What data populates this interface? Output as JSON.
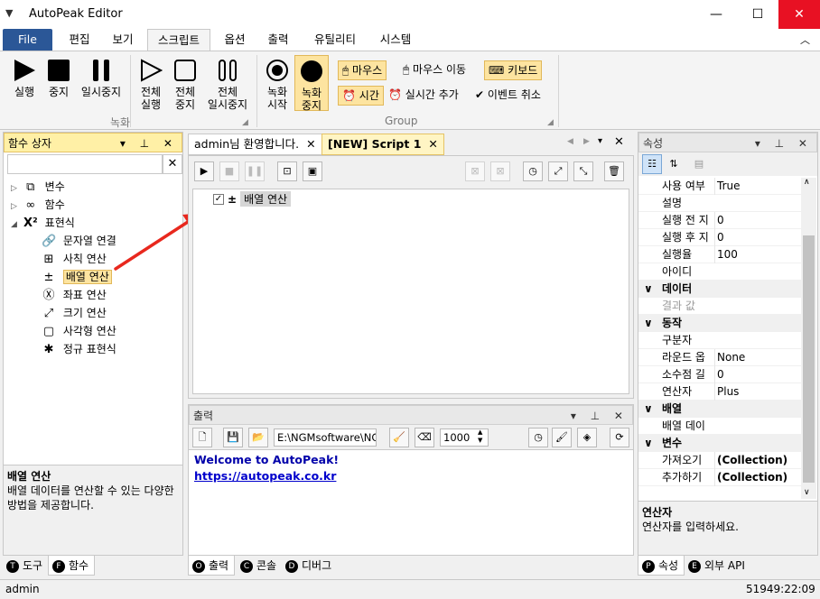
{
  "window": {
    "title": "AutoPeak Editor"
  },
  "menu": {
    "tabs": [
      "File",
      "편집",
      "보기",
      "스크립트",
      "옵션",
      "출력",
      "유틸리티",
      "시스템"
    ]
  },
  "ribbon": {
    "run": "실행",
    "stop": "중지",
    "pause": "일시중지",
    "run_all": "전체\n실행",
    "stop_all": "전체\n중지",
    "pause_all": "전체\n일시중지",
    "group_record": "녹화",
    "rec_start": "녹화\n시작",
    "rec_stop": "녹화\n중지",
    "mouse": "마우스",
    "mouse_move": "마우스 이동",
    "keyboard": "키보드",
    "time": "시간",
    "realtime_add": "실시간 추가",
    "event_cancel": "이벤트 취소",
    "group_group": "Group"
  },
  "left_panel": {
    "title": "함수 상자",
    "tree": [
      {
        "label": "변수",
        "icon": "variable-icon",
        "expand": "▷"
      },
      {
        "label": "함수",
        "icon": "function-icon",
        "expand": "▷"
      },
      {
        "label": "표현식",
        "icon": "x-squared-icon",
        "expand": "◢"
      }
    ],
    "children": [
      {
        "label": "문자열 연결",
        "icon": "link-icon"
      },
      {
        "label": "사칙 연산",
        "icon": "calculator-icon"
      },
      {
        "label": "배열 연산",
        "icon": "plus-minus-icon"
      },
      {
        "label": "좌표 연산",
        "icon": "xy-icon"
      },
      {
        "label": "크기 연산",
        "icon": "resize-icon"
      },
      {
        "label": "사각형 연산",
        "icon": "rectangle-icon"
      },
      {
        "label": "정규 표현식",
        "icon": "asterisk-icon"
      }
    ],
    "desc_title": "배열 연산",
    "desc_body": "배열 데이터를 연산할 수 있는 다양한 방법을 제공합니다.",
    "tabs": [
      "도구",
      "함수"
    ],
    "tab_badges": [
      "T",
      "F"
    ]
  },
  "editor": {
    "tabs": [
      {
        "label": "admin님 환영합니다."
      },
      {
        "label": "[NEW] Script 1"
      }
    ],
    "item_label": "배열 연산",
    "item_sign": "±"
  },
  "output": {
    "title": "출력",
    "path": "E:\\NGMsoftware\\NG",
    "count": "1000",
    "welcome": "Welcome to AutoPeak!",
    "link": "https://autopeak.co.kr",
    "tabs": [
      "출력",
      "콘솔",
      "디버그"
    ],
    "tab_badges": [
      "O",
      "C",
      "D"
    ]
  },
  "props": {
    "title": "속성",
    "rows": [
      {
        "name": "사용 여부",
        "value": "True"
      },
      {
        "name": "설명",
        "value": ""
      },
      {
        "name": "실행 전 지",
        "value": "0"
      },
      {
        "name": "실행 후 지",
        "value": "0"
      },
      {
        "name": "실행율",
        "value": "100"
      },
      {
        "name": "아이디",
        "value": ""
      }
    ],
    "cat_data": "데이터",
    "result_value": "결과 값",
    "cat_action": "동작",
    "action_rows": [
      {
        "name": "구분자",
        "value": ""
      },
      {
        "name": "라운드 옵",
        "value": "None"
      },
      {
        "name": "소수점 길",
        "value": "0"
      },
      {
        "name": "연산자",
        "value": "Plus"
      }
    ],
    "cat_array": "배열",
    "array_data": "배열 데이",
    "cat_var": "변수",
    "var_rows": [
      {
        "name": "가져오기",
        "value": "(Collection)"
      },
      {
        "name": "추가하기",
        "value": "(Collection)"
      }
    ],
    "desc_title": "연산자",
    "desc_body": "연산자를 입력하세요.",
    "tabs": [
      "속성",
      "외부 API"
    ],
    "tab_badges": [
      "P",
      "E"
    ]
  },
  "status": {
    "user": "admin",
    "time": "51949:22:09"
  }
}
